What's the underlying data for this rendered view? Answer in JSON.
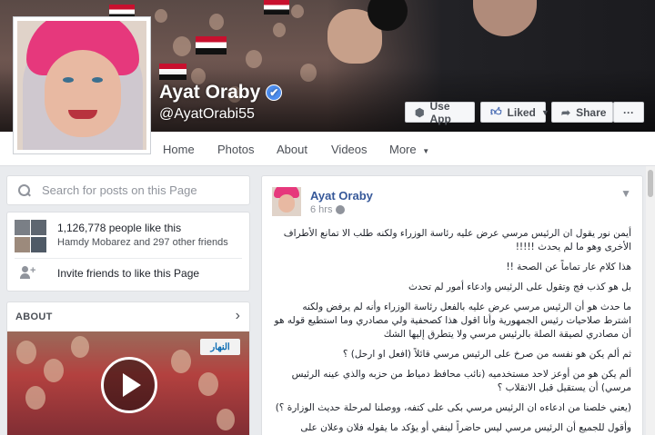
{
  "profile": {
    "name": "Ayat Oraby",
    "handle": "@AyatOrabi55",
    "verified_mark": "✔"
  },
  "cover_buttons": {
    "use_app": "Use App",
    "liked": "Liked",
    "share": "Share",
    "more": "···"
  },
  "nav": {
    "items": [
      "Home",
      "Photos",
      "About",
      "Videos",
      "More"
    ]
  },
  "search": {
    "placeholder": "Search for posts on this Page"
  },
  "likes": {
    "count": "1,126,778 people like this",
    "friends": "Hamdy Mobarez and 297 other friends",
    "invite": "Invite friends to like this Page"
  },
  "about": {
    "header": "ABOUT",
    "video_logo": "النهار"
  },
  "post": {
    "author": "Ayat Oraby",
    "time": "6 hrs",
    "paragraphs": [
      "أيمن نور يقول ان الرئيس مرسي عرض عليه رئاسة الوزراء ولكنه طلب الا تمانع الأطراف الأخرى وهو ما لم يحدث !!!!!",
      "هذا كلام عار تماماً عن الصحة !!",
      "بل هو كذب فج وتقول على الرئيس وادعاء أمور لم تحدث",
      "ما حدث هو أن الرئيس مرسي عرض عليه بالفعل رئاسة الوزراء وأنه لم يرفض ولكنه اشترط صلاحيات رئيس الجمهورية وأنا اقول هذا كصحفية ولي مصادري وما استطيع قوله هو أن مصادري لصيقة الصلة بالرئيس مرسي ولا يتطرق إليها الشك",
      "ثم ألم يكن هو نفسه من صرخ على الرئيس مرسي قائلاً (افعل او ارحل) ؟",
      "ألم يكن هو من أوعز لاحد مستخدميه (نائب محافظ دمياط من حزبه والذي عينه الرئيس مرسي) أن يستقيل قبل الانقلاب ؟",
      "(يعني خلصنا من ادعاءه ان الرئيس مرسي بكى على كتفه، ووصلنا لمرحلة حديث الوزارة ؟)",
      "وأقول للجميع أن الرئيس مرسي ليس حاضراً لينفي أو يؤكد ما يقوله فلان وعلان على المقهى"
    ]
  },
  "colors": {
    "page_bg": "#e9ebee",
    "link_blue": "#365899",
    "verified_blue": "#4d8ef0",
    "hijab_pink": "#e6387c"
  },
  "icons": [
    "cube-icon",
    "thumbs-up-icon",
    "share-arrow-icon",
    "search-icon",
    "add-friend-icon",
    "chevron-right-icon",
    "globe-icon",
    "chevron-down-icon",
    "play-icon"
  ]
}
